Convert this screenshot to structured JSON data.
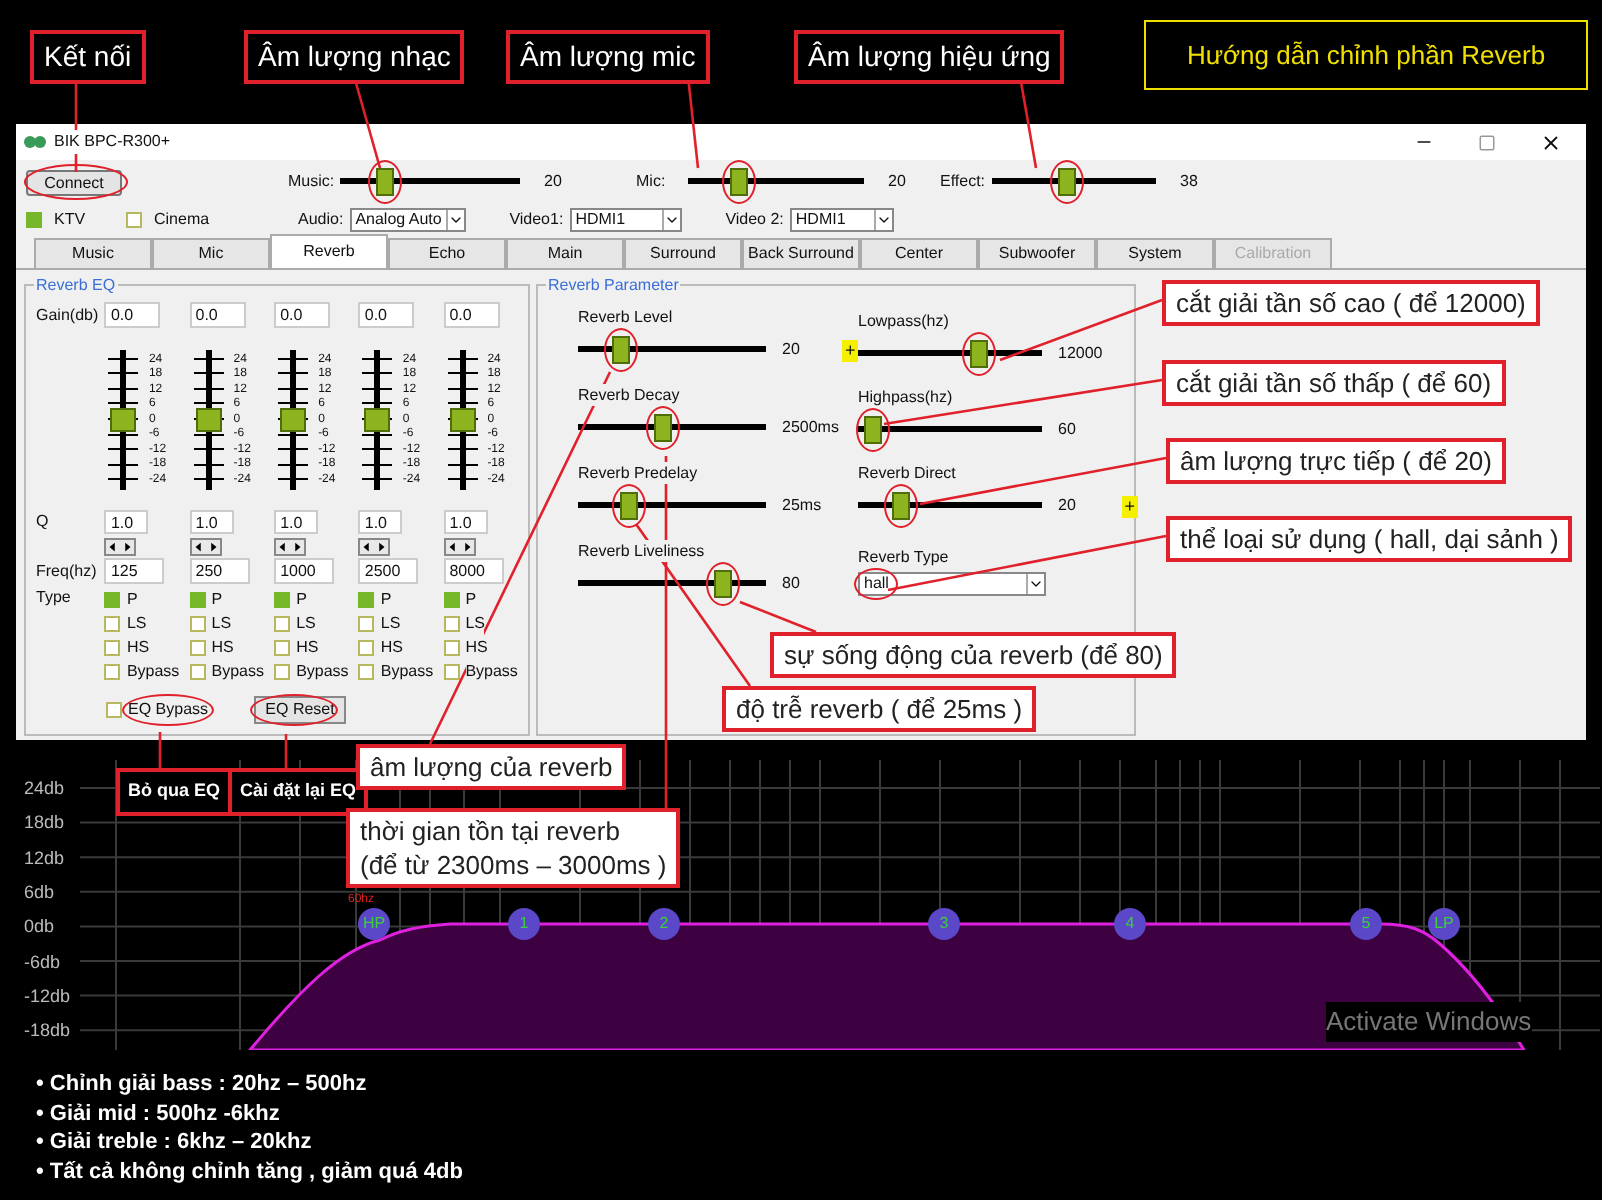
{
  "guide_title": "Hướng dẫn chỉnh phần Reverb",
  "callouts": [
    {
      "text": "Kết nối",
      "kind": "dark"
    },
    {
      "text": "Âm lượng nhạc",
      "kind": "dark"
    },
    {
      "text": "Âm lượng mic",
      "kind": "dark"
    },
    {
      "text": "Âm lượng hiệu ứng",
      "kind": "dark"
    },
    {
      "text": "cắt giải tần số cao ( để 12000)",
      "kind": "light"
    },
    {
      "text": "cắt giải tần số thấp ( để 60)",
      "kind": "light"
    },
    {
      "text": "âm lượng trực tiếp ( để 20)",
      "kind": "light"
    },
    {
      "text": "thể loại sử dụng ( hall, dại sảnh )",
      "kind": "light"
    },
    {
      "text": "sự sống động của reverb (để 80)",
      "kind": "light"
    },
    {
      "text": "độ trễ reverb ( để 25ms )",
      "kind": "light"
    },
    {
      "text": "Bỏ qua EQ",
      "kind": "tag"
    },
    {
      "text": "Cài đặt lại EQ",
      "kind": "tag"
    },
    {
      "text": "âm lượng của reverb",
      "kind": "light"
    },
    {
      "text": "thời gian tồn tại reverb\n(để từ 2300ms – 3000ms )",
      "kind": "light"
    }
  ],
  "window": {
    "title": "BIK BPC-R300+",
    "connect": {
      "label": "Connect",
      "circled": true
    },
    "volumes": [
      {
        "label": "Music:",
        "level": 0.22,
        "reading": "20",
        "circled": true
      },
      {
        "label": "Mic:",
        "level": 0.26,
        "reading": "20",
        "circled": true
      },
      {
        "label": "Effect:",
        "level": 0.45,
        "reading": "38",
        "circled": true
      }
    ],
    "modes": [
      {
        "label": "KTV",
        "checked": true
      },
      {
        "label": "Cinema",
        "checked": false
      }
    ],
    "selects": [
      {
        "label": "Audio:",
        "value": "Analog Auto"
      },
      {
        "label": "Video1:",
        "value": "HDMI1"
      },
      {
        "label": "Video 2:",
        "value": "HDMI1"
      }
    ],
    "tabs": [
      {
        "label": "Music",
        "selected": false,
        "disabled": false
      },
      {
        "label": "Mic",
        "selected": false,
        "disabled": false
      },
      {
        "label": "Reverb",
        "selected": true,
        "disabled": false
      },
      {
        "label": "Echo",
        "selected": false,
        "disabled": false
      },
      {
        "label": "Main",
        "selected": false,
        "disabled": false
      },
      {
        "label": "Surround",
        "selected": false,
        "disabled": false
      },
      {
        "label": "Back Surround",
        "selected": false,
        "disabled": false
      },
      {
        "label": "Center",
        "selected": false,
        "disabled": false
      },
      {
        "label": "Subwoofer",
        "selected": false,
        "disabled": false
      },
      {
        "label": "System",
        "selected": false,
        "disabled": false
      },
      {
        "label": "Calibration",
        "selected": false,
        "disabled": true
      }
    ],
    "reverb_eq": {
      "title": "Reverb EQ",
      "gain_label": "Gain(db)",
      "q_label": "Q",
      "freq_label": "Freq(hz)",
      "type_label": "Type",
      "bands": [
        {
          "gain": "0.0",
          "level": 0.5,
          "scale": [
            "24",
            "18",
            "12",
            "6",
            "0",
            "-6",
            "-12",
            "-18",
            "-24"
          ],
          "q": "1.0",
          "freq": "125",
          "types": [
            {
              "label": "P",
              "checked": true
            },
            {
              "label": "LS",
              "checked": false
            },
            {
              "label": "HS",
              "checked": false
            },
            {
              "label": "Bypass",
              "checked": false
            }
          ]
        },
        {
          "gain": "0.0",
          "level": 0.5,
          "scale": [
            "24",
            "18",
            "12",
            "6",
            "0",
            "-6",
            "-12",
            "-18",
            "-24"
          ],
          "q": "1.0",
          "freq": "250",
          "types": [
            {
              "label": "P",
              "checked": true
            },
            {
              "label": "LS",
              "checked": false
            },
            {
              "label": "HS",
              "checked": false
            },
            {
              "label": "Bypass",
              "checked": false
            }
          ]
        },
        {
          "gain": "0.0",
          "level": 0.5,
          "scale": [
            "24",
            "18",
            "12",
            "6",
            "0",
            "-6",
            "-12",
            "-18",
            "-24"
          ],
          "q": "1.0",
          "freq": "1000",
          "types": [
            {
              "label": "P",
              "checked": true
            },
            {
              "label": "LS",
              "checked": false
            },
            {
              "label": "HS",
              "checked": false
            },
            {
              "label": "Bypass",
              "checked": false
            }
          ]
        },
        {
          "gain": "0.0",
          "level": 0.5,
          "scale": [
            "24",
            "18",
            "12",
            "6",
            "0",
            "-6",
            "-12",
            "-18",
            "-24"
          ],
          "q": "1.0",
          "freq": "2500",
          "types": [
            {
              "label": "P",
              "checked": true
            },
            {
              "label": "LS",
              "checked": false
            },
            {
              "label": "HS",
              "checked": false
            },
            {
              "label": "Bypass",
              "checked": false
            }
          ]
        },
        {
          "gain": "0.0",
          "level": 0.5,
          "scale": [
            "24",
            "18",
            "12",
            "6",
            "0",
            "-6",
            "-12",
            "-18",
            "-24"
          ],
          "q": "1.0",
          "freq": "8000",
          "types": [
            {
              "label": "P",
              "checked": true
            },
            {
              "label": "LS",
              "checked": false
            },
            {
              "label": "HS",
              "checked": false
            },
            {
              "label": "Bypass",
              "checked": false
            }
          ]
        }
      ],
      "bypass": {
        "label": "EQ Bypass",
        "checked": false,
        "circled": true
      },
      "reset": {
        "label": "EQ Reset",
        "circled": true
      }
    },
    "reverb_parameter": {
      "title": "Reverb Parameter",
      "left": [
        {
          "label": "Reverb Level",
          "level": 0.2,
          "reading": "20",
          "plus": "+",
          "circled": true
        },
        {
          "label": "Reverb Decay",
          "level": 0.45,
          "reading": "2500ms",
          "circled": true
        },
        {
          "label": "Reverb Predelay",
          "level": 0.25,
          "reading": "25ms",
          "circled": true
        },
        {
          "label": "Reverb Liveliness",
          "level": 0.8,
          "reading": "80",
          "circled": true
        }
      ],
      "right": [
        {
          "label": "Lowpass(hz)",
          "level": 0.67,
          "reading": "12000",
          "circled": true
        },
        {
          "label": "Highpass(hz)",
          "level": 0.04,
          "reading": "60",
          "circled": true
        },
        {
          "label": "Reverb Direct",
          "level": 0.2,
          "reading": "20",
          "plus": "+",
          "circled": true
        }
      ],
      "type": {
        "label": "Reverb Type",
        "value": "hall",
        "circled": true
      }
    }
  },
  "graph": {
    "y_labels": [
      "24db",
      "18db",
      "12db",
      "6db",
      "0db",
      "-6db",
      "-12db",
      "-18db"
    ],
    "hp_label": "60hz",
    "nodes": [
      "HP",
      "1",
      "2",
      "3",
      "4",
      "5",
      "LP"
    ]
  },
  "watermark": "Activate Windows",
  "notes": [
    "• Chỉnh giải bass : 20hz – 500hz",
    "• Giải mid : 500hz -6khz",
    "• Giải treble : 6khz – 20khz",
    "• Tất cả không chỉnh tăng , giảm quá 4db"
  ]
}
